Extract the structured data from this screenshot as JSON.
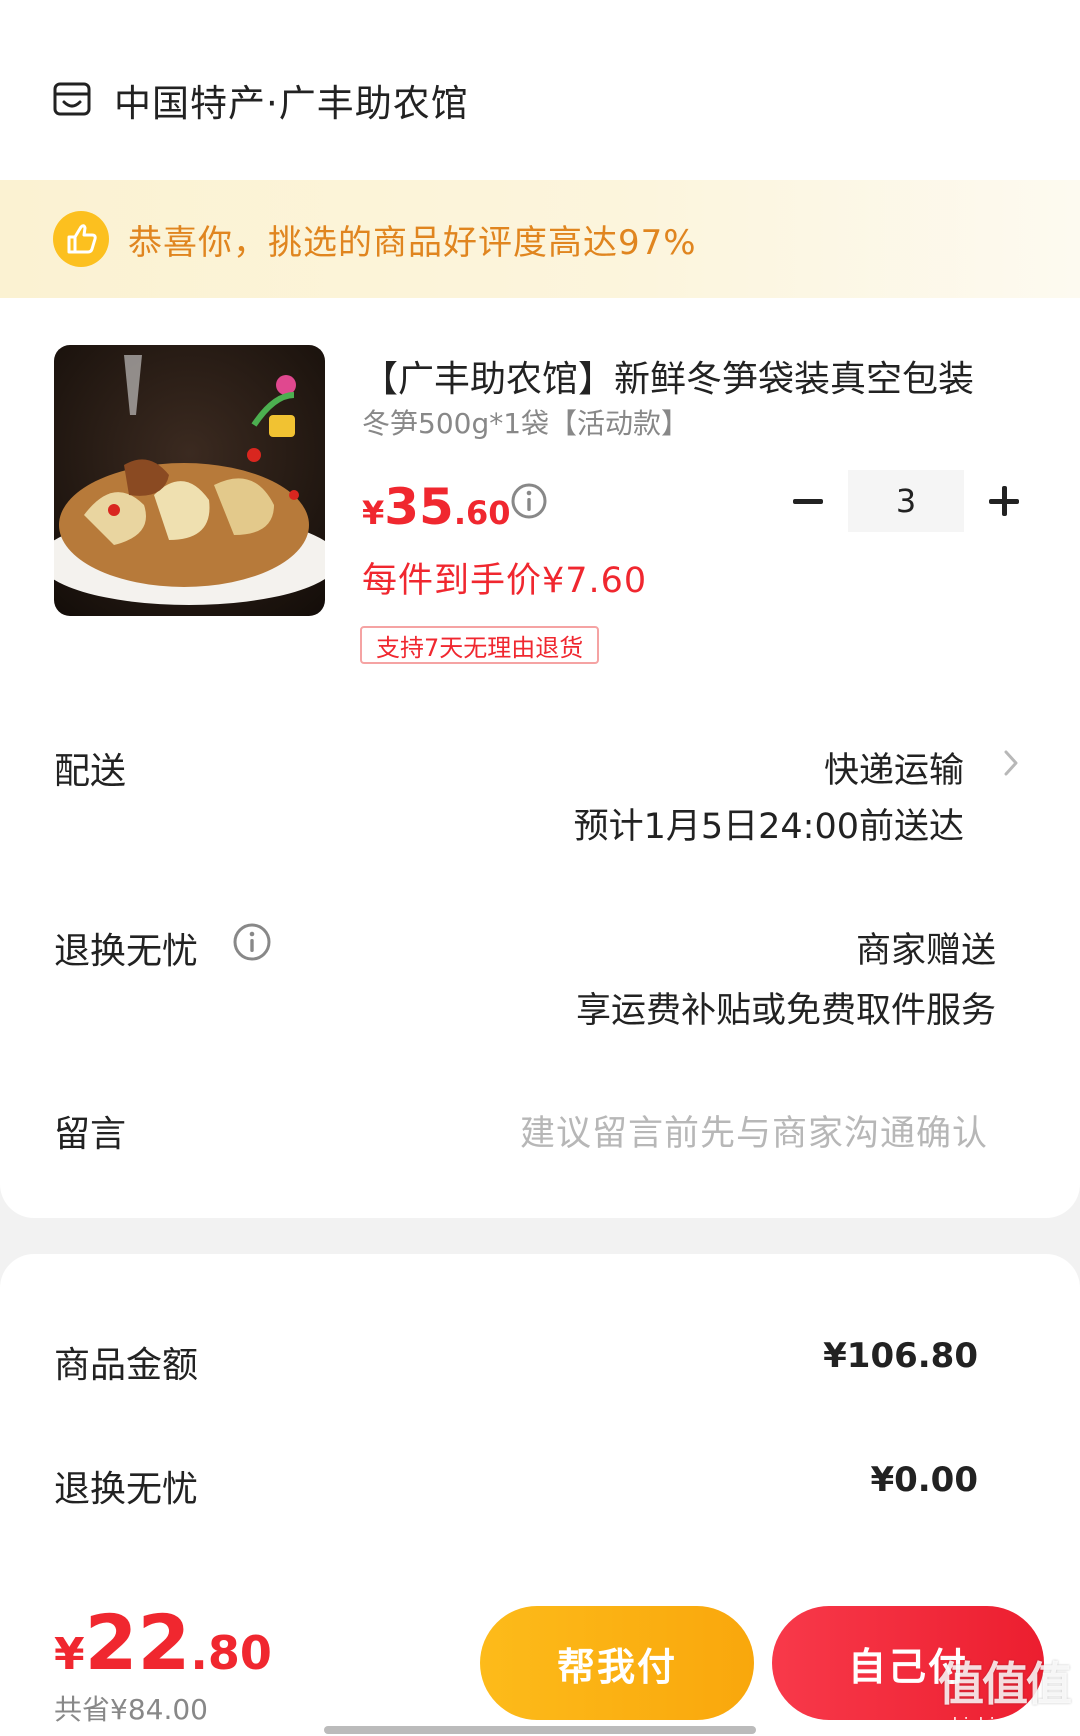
{
  "store": {
    "name": "中国特产·广丰助农馆",
    "icon": "store-icon"
  },
  "banner": {
    "text": "恭喜你，挑选的商品好评度高达97%",
    "icon": "thumbs-up-icon",
    "color": "#e0851f"
  },
  "product": {
    "title": "【广丰助农馆】新鲜冬笋袋装真空包装",
    "spec": "冬笋500g*1袋【活动款】",
    "price_yen": "¥",
    "price_int": "35",
    "price_dec": ".60",
    "quantity": "3",
    "unit_price": "每件到手价¥7.60",
    "return_badge": "支持7天无理由退货"
  },
  "delivery": {
    "label": "配送",
    "method": "快递运输",
    "eta": "预计1月5日24:00前送达"
  },
  "return_service": {
    "label": "退换无忧",
    "value": "商家赠送",
    "desc": "享运费补贴或免费取件服务"
  },
  "message": {
    "label": "留言",
    "placeholder": "建议留言前先与商家沟通确认"
  },
  "summary": [
    {
      "label": "商品金额",
      "value": "¥106.80"
    },
    {
      "label": "退换无忧",
      "value": "¥0.00"
    }
  ],
  "footer": {
    "total_yen": "¥",
    "total_int": "22",
    "total_dec": ".80",
    "saved": "共省¥84.00",
    "help_pay_label": "帮我付",
    "self_pay_label": "自己付"
  },
  "watermark": {
    "main": "值值值",
    "sub": "zhizhizhi.com"
  },
  "colors": {
    "accent_red": "#f0272f",
    "help_yellow": "#fdbb1a",
    "banner_bg": "#fbf2d2"
  }
}
